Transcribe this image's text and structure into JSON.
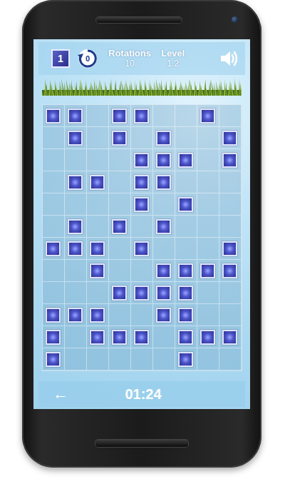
{
  "top_bar": {
    "moves_badge": "1",
    "rotation_counter": "0",
    "rotations": {
      "label": "Rotations",
      "value": "10"
    },
    "level": {
      "label": "Level",
      "value": "1.2"
    },
    "sound_on": true
  },
  "grid": {
    "rows": [
      [
        true,
        true,
        false,
        true,
        true,
        false,
        false,
        true,
        false
      ],
      [
        false,
        true,
        false,
        true,
        false,
        true,
        false,
        false,
        true
      ],
      [
        false,
        false,
        false,
        false,
        true,
        true,
        true,
        false,
        true
      ],
      [
        false,
        true,
        true,
        false,
        true,
        true,
        false,
        false,
        false
      ],
      [
        false,
        false,
        false,
        false,
        true,
        false,
        true,
        false,
        false
      ],
      [
        false,
        true,
        false,
        true,
        false,
        true,
        false,
        false,
        false
      ],
      [
        true,
        true,
        true,
        false,
        true,
        false,
        false,
        false,
        true
      ],
      [
        false,
        false,
        true,
        false,
        false,
        true,
        true,
        true,
        true
      ],
      [
        false,
        false,
        false,
        true,
        true,
        true,
        true,
        false,
        false
      ],
      [
        true,
        true,
        true,
        false,
        false,
        true,
        true,
        false,
        false
      ],
      [
        true,
        false,
        true,
        true,
        true,
        false,
        true,
        true,
        true
      ],
      [
        true,
        false,
        false,
        false,
        false,
        false,
        true,
        false,
        false
      ]
    ]
  },
  "bottom_bar": {
    "back": "←",
    "timer": "01:24"
  }
}
